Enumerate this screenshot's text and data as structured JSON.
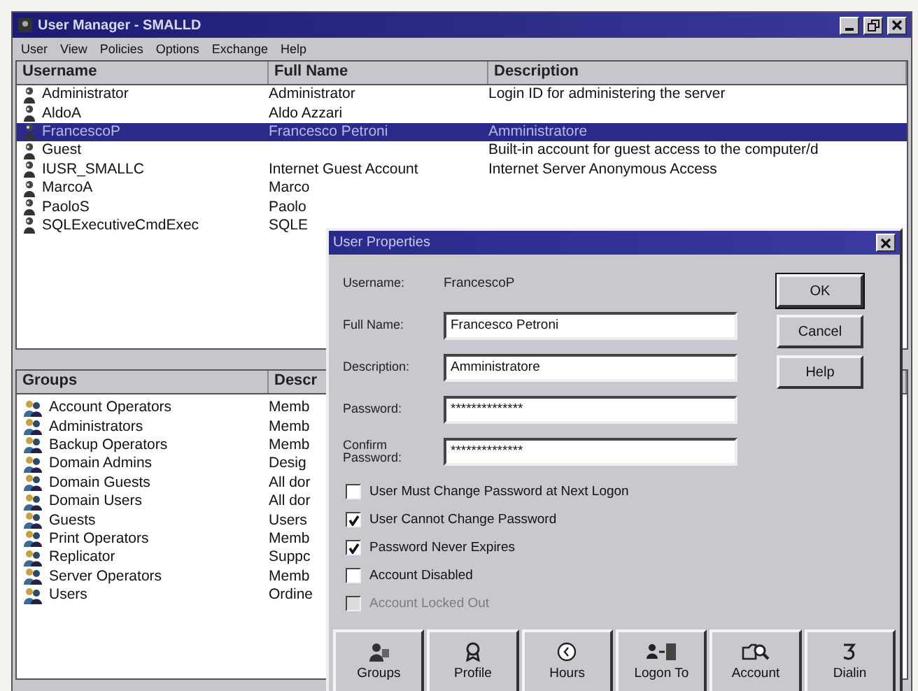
{
  "window": {
    "title": "User Manager - SMALLD"
  },
  "menu": [
    {
      "label": "User"
    },
    {
      "label": "View"
    },
    {
      "label": "Policies"
    },
    {
      "label": "Options"
    },
    {
      "label": "Exchange"
    },
    {
      "label": "Help"
    }
  ],
  "users": {
    "columns": [
      "Username",
      "Full Name",
      "Description"
    ],
    "rows": [
      {
        "username": "Administrator",
        "full_name": "Administrator",
        "description": "Login ID for administering the server",
        "selected": false
      },
      {
        "username": "AldoA",
        "full_name": "Aldo Azzari",
        "description": "",
        "selected": false
      },
      {
        "username": "FrancescoP",
        "full_name": "Francesco Petroni",
        "description": "Amministratore",
        "selected": true
      },
      {
        "username": "Guest",
        "full_name": "",
        "description": "Built-in account for guest access to the computer/d",
        "selected": false
      },
      {
        "username": "IUSR_SMALLC",
        "full_name": "Internet Guest Account",
        "description": "Internet Server Anonymous Access",
        "selected": false
      },
      {
        "username": "MarcoA",
        "full_name": "Marco",
        "description": "",
        "selected": false
      },
      {
        "username": "PaoloS",
        "full_name": "Paolo",
        "description": "",
        "selected": false
      },
      {
        "username": "SQLExecutiveCmdExec",
        "full_name": "SQLE",
        "description": "",
        "selected": false
      }
    ]
  },
  "groups": {
    "columns": [
      "Groups",
      "Descr"
    ],
    "rows": [
      {
        "name": "Account Operators",
        "description": "Memb"
      },
      {
        "name": "Administrators",
        "description": "Memb"
      },
      {
        "name": "Backup Operators",
        "description": "Memb"
      },
      {
        "name": "Domain Admins",
        "description": "Desig"
      },
      {
        "name": "Domain Guests",
        "description": "All dor"
      },
      {
        "name": "Domain Users",
        "description": "All dor"
      },
      {
        "name": "Guests",
        "description": "Users"
      },
      {
        "name": "Print Operators",
        "description": "Memb"
      },
      {
        "name": "Replicator",
        "description": "Suppc"
      },
      {
        "name": "Server Operators",
        "description": "Memb"
      },
      {
        "name": "Users",
        "description": "Ordine"
      }
    ]
  },
  "dialog": {
    "title": "User Properties",
    "username_label": "Username:",
    "username": "FrancescoP",
    "fields": [
      {
        "label": "Full Name:",
        "value": "Francesco Petroni"
      },
      {
        "label": "Description:",
        "value": "Amministratore"
      },
      {
        "label": "Password:",
        "value": "**************"
      },
      {
        "label": "Confirm Password:",
        "value": "**************"
      }
    ],
    "buttons": [
      "OK",
      "Cancel",
      "Help"
    ],
    "checkboxes": [
      {
        "label": "User Must Change Password at Next Logon",
        "checked": false,
        "disabled": false
      },
      {
        "label": "User Cannot Change Password",
        "checked": true,
        "disabled": false
      },
      {
        "label": "Password Never Expires",
        "checked": true,
        "disabled": false
      },
      {
        "label": "Account Disabled",
        "checked": false,
        "disabled": false
      },
      {
        "label": "Account Locked Out",
        "checked": false,
        "disabled": true
      }
    ],
    "tools": [
      {
        "label": "Groups",
        "kind": "groups"
      },
      {
        "label": "Profile",
        "kind": "profile"
      },
      {
        "label": "Hours",
        "kind": "hours"
      },
      {
        "label": "Logon To",
        "kind": "logon"
      },
      {
        "label": "Account",
        "kind": "account"
      },
      {
        "label": "Dialin",
        "kind": "dialin"
      }
    ]
  }
}
